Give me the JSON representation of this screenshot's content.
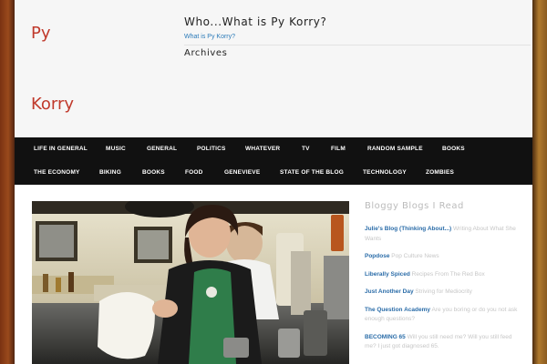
{
  "site": {
    "logo_line1": "Py",
    "logo_line2": "Korry"
  },
  "header": {
    "title": "Who...What is Py Korry?",
    "link": "What is Py Korry?",
    "archives": "Archives"
  },
  "nav": {
    "row1": [
      "LIFE IN GENERAL",
      "MUSIC",
      "GENERAL",
      "POLITICS",
      "WHATEVER",
      "TV",
      "FILM",
      "RANDOM SAMPLE",
      "BOOKS"
    ],
    "row2": [
      "THE ECONOMY",
      "BIKING",
      "BOOKS",
      "FOOD",
      "GENEVIEVE",
      "STATE OF THE BLOG",
      "TECHNOLOGY",
      "ZOMBIES"
    ]
  },
  "sidebar": {
    "title": "Bloggy Blogs I Read",
    "items": [
      {
        "link": "Julie's Blog (Thinking About...)",
        "desc": " Writing About What She Wants"
      },
      {
        "link": "Popdose",
        "desc": " Pop Culture News"
      },
      {
        "link": "Liberally Spiced",
        "desc": " Recipes From The Red Box"
      },
      {
        "link": "Just Another Day",
        "desc": " Striving for Mediocrity"
      },
      {
        "link": "The Question Academy",
        "desc": " Are you boring or do you not ask enough questions?"
      },
      {
        "link": "BECOMING 65",
        "desc": " Will you still need me? Will you still feed me? I just got diagnosed 65."
      }
    ]
  }
}
